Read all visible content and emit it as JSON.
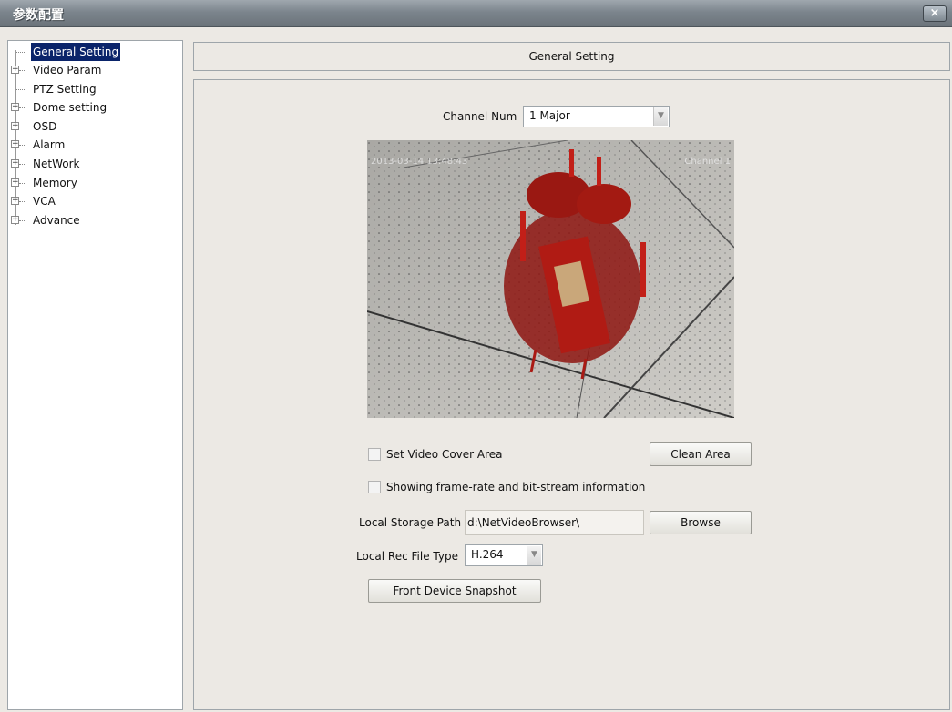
{
  "window": {
    "title": "参数配置",
    "close_glyph": "×"
  },
  "tree": {
    "items": [
      {
        "label": "General Setting",
        "expandable": false,
        "selected": true
      },
      {
        "label": "Video Param",
        "expandable": true
      },
      {
        "label": "PTZ Setting",
        "expandable": false
      },
      {
        "label": "Dome setting",
        "expandable": true
      },
      {
        "label": "OSD",
        "expandable": true
      },
      {
        "label": "Alarm",
        "expandable": true
      },
      {
        "label": "NetWork",
        "expandable": true
      },
      {
        "label": "Memory",
        "expandable": true
      },
      {
        "label": "VCA",
        "expandable": true
      },
      {
        "label": "Advance",
        "expandable": true
      }
    ]
  },
  "header": {
    "title": "General Setting"
  },
  "channel": {
    "label": "Channel Num",
    "value": "1 Major"
  },
  "video": {
    "osd_datetime": "2013-03-14 13:48:43",
    "osd_channel": "Channel 1"
  },
  "options": {
    "cover_area_label": "Set Video Cover Area",
    "clean_area_button": "Clean Area",
    "framerate_label": "Showing frame-rate and bit-stream information"
  },
  "storage": {
    "label": "Local Storage Path",
    "value": "d:\\NetVideoBrowser\\",
    "browse_button": "Browse"
  },
  "rec_type": {
    "label": "Local Rec File Type",
    "value": "H.264"
  },
  "snapshot_button": "Front Device Snapshot",
  "icons": {
    "expander": "plus-expander-icon",
    "dropdown": "chevron-down-icon",
    "close": "close-icon"
  }
}
